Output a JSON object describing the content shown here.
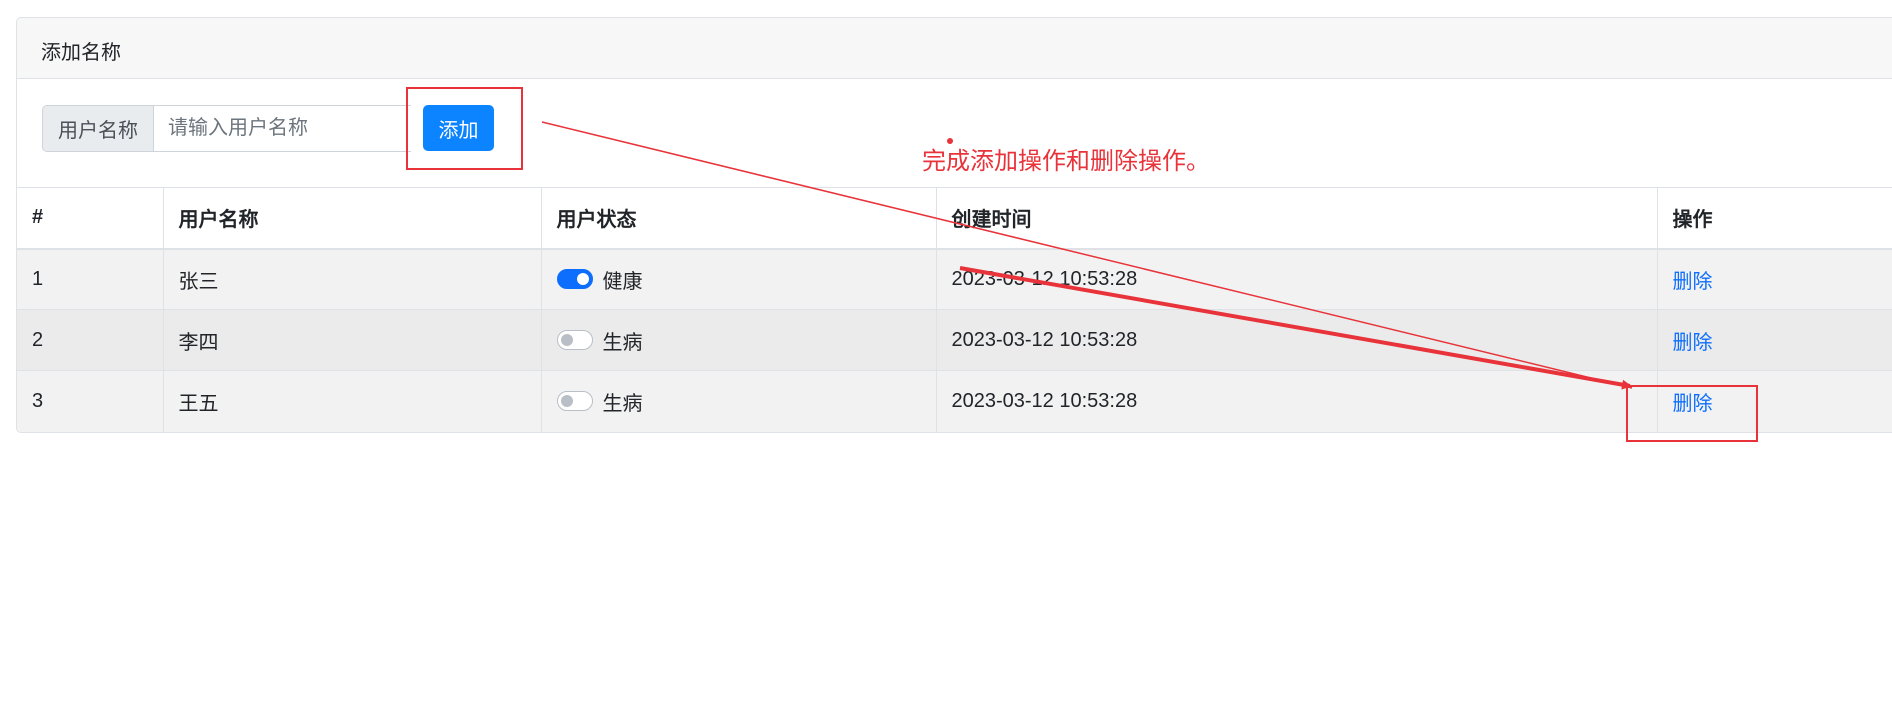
{
  "card": {
    "header_title": "添加名称"
  },
  "form": {
    "prefix_label": "用户名称",
    "input_value": "",
    "input_placeholder": "请输入用户名称",
    "add_label": "添加"
  },
  "table": {
    "headers": [
      "#",
      "用户名称",
      "用户状态",
      "创建时间",
      "操作"
    ],
    "rows": [
      {
        "id": "1",
        "name": "张三",
        "status_on": true,
        "status_label": "健康",
        "created": "2023-03-12 10:53:28",
        "action": "删除"
      },
      {
        "id": "2",
        "name": "李四",
        "status_on": false,
        "status_label": "生病",
        "created": "2023-03-12 10:53:28",
        "action": "删除"
      },
      {
        "id": "3",
        "name": "王五",
        "status_on": false,
        "status_label": "生病",
        "created": "2023-03-12 10:53:28",
        "action": "删除"
      }
    ]
  },
  "annotation": {
    "note": "完成添加操作和删除操作。",
    "color": "#e8333a"
  },
  "colors": {
    "primary": "#0d84ff",
    "switch_on": "#0d6efd",
    "link": "#0d6efd"
  }
}
